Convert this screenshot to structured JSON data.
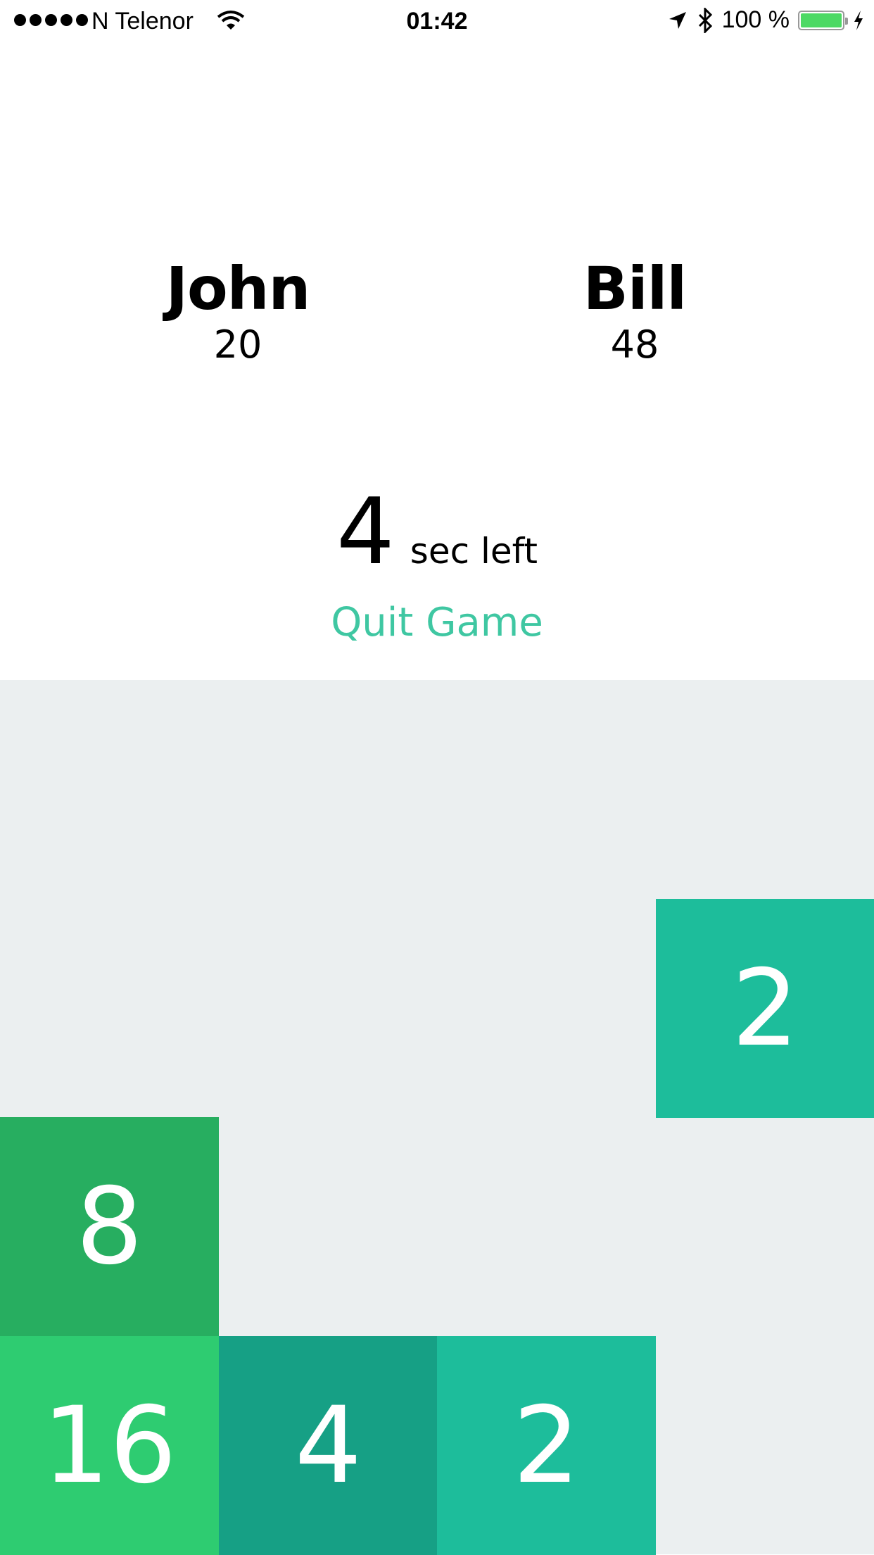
{
  "status_bar": {
    "carrier": "N Telenor",
    "time": "01:42",
    "battery": "100 %",
    "icons": [
      "signal-dots-icon",
      "wifi-icon",
      "location-arrow-icon",
      "bluetooth-icon",
      "battery-icon",
      "charging-bolt-icon"
    ]
  },
  "players": [
    {
      "name": "John",
      "score": "20"
    },
    {
      "name": "Bill",
      "score": "48"
    }
  ],
  "timer": {
    "seconds": "4",
    "label": "sec left"
  },
  "quit_label": "Quit Game",
  "colors": {
    "accent": "#3fc7a2",
    "board_bg": "#ebeff0",
    "tile_2": "#1dbd9b",
    "tile_4": "#16a085",
    "tile_8": "#27ae60",
    "tile_16": "#2ecc71"
  },
  "board": {
    "rows": 4,
    "cols": 4,
    "tiles": [
      {
        "value": "2",
        "row": 1,
        "col": 3,
        "color": "#1dbd9b"
      },
      {
        "value": "8",
        "row": 2,
        "col": 0,
        "color": "#27ae60"
      },
      {
        "value": "16",
        "row": 3,
        "col": 0,
        "color": "#2ecc71"
      },
      {
        "value": "4",
        "row": 3,
        "col": 1,
        "color": "#16a085"
      },
      {
        "value": "2",
        "row": 3,
        "col": 2,
        "color": "#1dbd9b"
      }
    ]
  }
}
